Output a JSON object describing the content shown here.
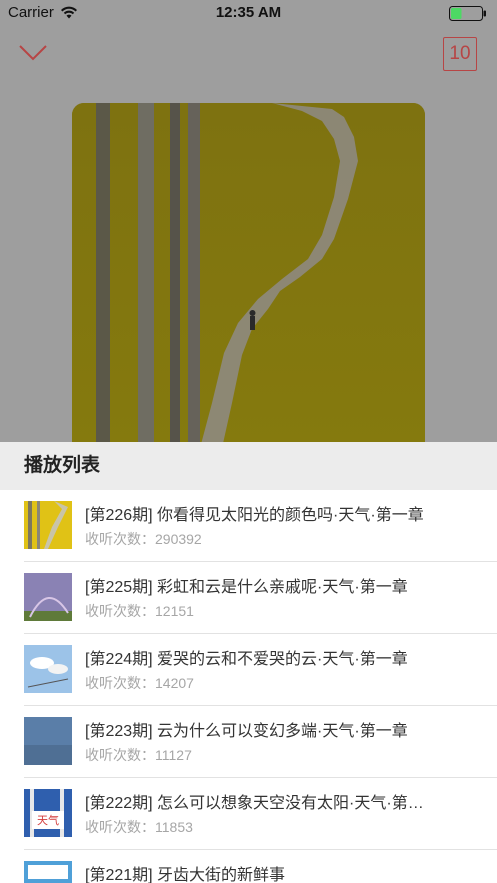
{
  "status": {
    "carrier": "Carrier",
    "time": "12:35 AM",
    "battery_level": 0.35
  },
  "header": {
    "collapse_icon": "chevron-down-icon",
    "count": "10",
    "accent": "#b74545"
  },
  "cover": {
    "description_icon": "cover-art"
  },
  "playlist": {
    "title": "播放列表",
    "plays_label": "收听次数：",
    "items": [
      {
        "title": "[第226期] 你看得见太阳光的颜色吗·天气·第一章",
        "plays": "收听次数：290392",
        "thumb": "yellow"
      },
      {
        "title": "[第225期] 彩虹和云是什么亲戚呢·天气·第一章",
        "plays": "收听次数：12151",
        "thumb": "rainbow"
      },
      {
        "title": "[第224期] 爱哭的云和不爱哭的云·天气·第一章",
        "plays": "收听次数：14207",
        "thumb": "clouds"
      },
      {
        "title": "[第223期] 云为什么可以变幻多端·天气·第一章",
        "plays": "收听次数：11127",
        "thumb": "bluesky"
      },
      {
        "title": "[第222期] 怎么可以想象天空没有太阳·天气·第…",
        "plays": "收听次数：11853",
        "thumb": "book"
      },
      {
        "title": "[第221期] 牙齿大街的新鲜事",
        "plays": "",
        "thumb": "book2"
      }
    ],
    "thumb_book_label": "天气"
  }
}
